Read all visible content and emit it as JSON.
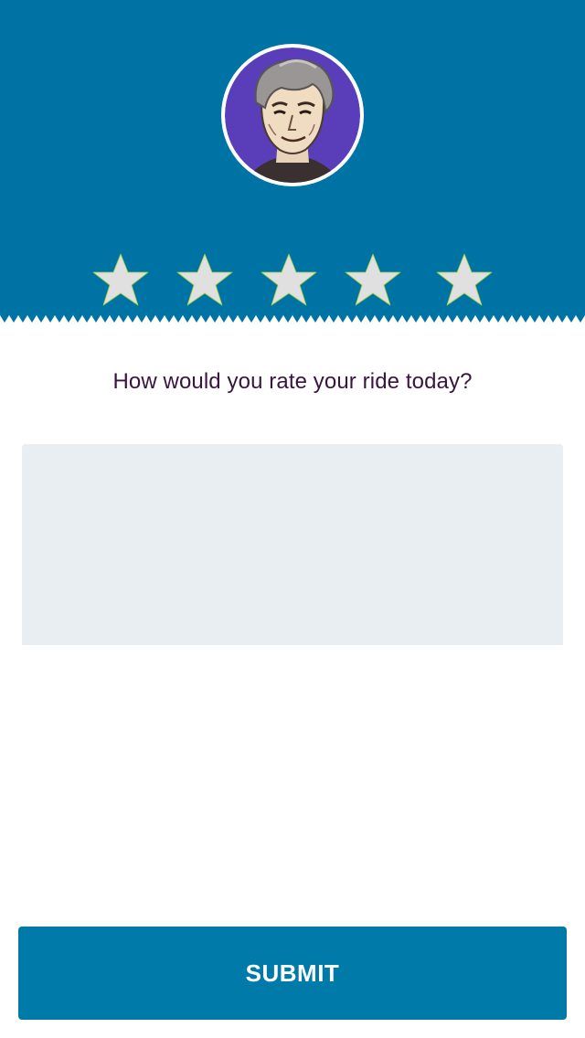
{
  "header": {
    "background_color": "#0073a5",
    "avatar": {
      "icon": "driver-avatar-cartoon",
      "ring_color": "#ffffff",
      "bg_color": "#5a3db8"
    }
  },
  "rating": {
    "max_stars": 5,
    "selected": 0,
    "star_color": "#e0e0e0",
    "star_outline_color": "#9ccf3a"
  },
  "prompt": {
    "text": "How would you rate your ride today?",
    "color": "#3a1440"
  },
  "comment": {
    "value": "",
    "placeholder": "",
    "background_color": "#e9eef2"
  },
  "submit": {
    "label": "SUBMIT",
    "background_color": "#007aa8"
  }
}
